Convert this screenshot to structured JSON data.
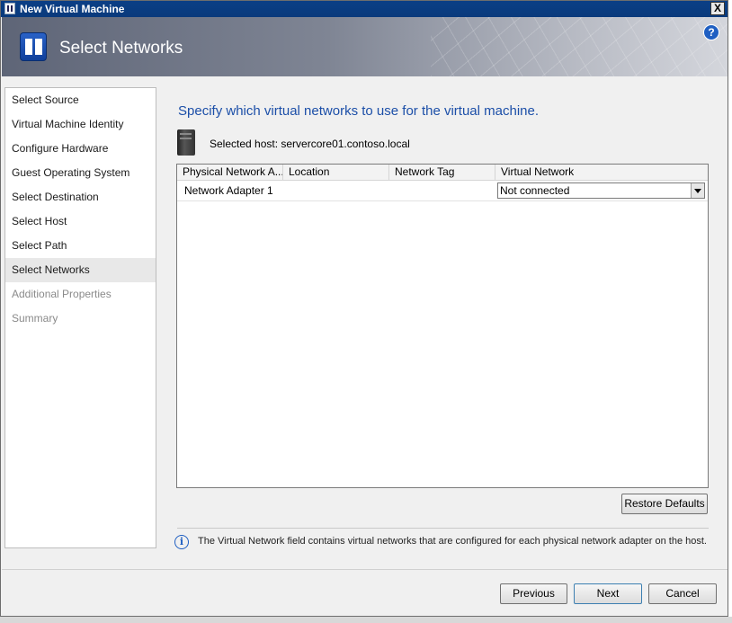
{
  "window": {
    "title": "New Virtual Machine",
    "close_label": "X"
  },
  "header": {
    "title": "Select Networks",
    "help_label": "?"
  },
  "nav": {
    "items": [
      {
        "label": "Select Source",
        "state": "normal"
      },
      {
        "label": "Virtual Machine Identity",
        "state": "normal"
      },
      {
        "label": "Configure Hardware",
        "state": "normal"
      },
      {
        "label": "Guest Operating System",
        "state": "normal"
      },
      {
        "label": "Select Destination",
        "state": "normal"
      },
      {
        "label": "Select Host",
        "state": "normal"
      },
      {
        "label": "Select Path",
        "state": "normal"
      },
      {
        "label": "Select Networks",
        "state": "selected"
      },
      {
        "label": "Additional Properties",
        "state": "disabled"
      },
      {
        "label": "Summary",
        "state": "disabled"
      }
    ]
  },
  "main": {
    "heading": "Specify which virtual networks to use for the virtual machine.",
    "selected_host": "Selected host: servercore01.contoso.local",
    "table": {
      "columns": [
        "Physical Network A...",
        "Location",
        "Network Tag",
        "Virtual Network"
      ],
      "rows": [
        {
          "name": "Network Adapter 1",
          "location": "",
          "network_tag": "",
          "virtual_network": "Not connected"
        }
      ]
    },
    "restore_defaults_label": "Restore Defaults",
    "info_text": "The Virtual Network field contains virtual networks that are configured for each physical network adapter on the host."
  },
  "footer": {
    "previous_label": "Previous",
    "next_label": "Next",
    "cancel_label": "Cancel"
  },
  "colors": {
    "heading": "#1c4fa8",
    "titlebar": "#0b3f86"
  }
}
